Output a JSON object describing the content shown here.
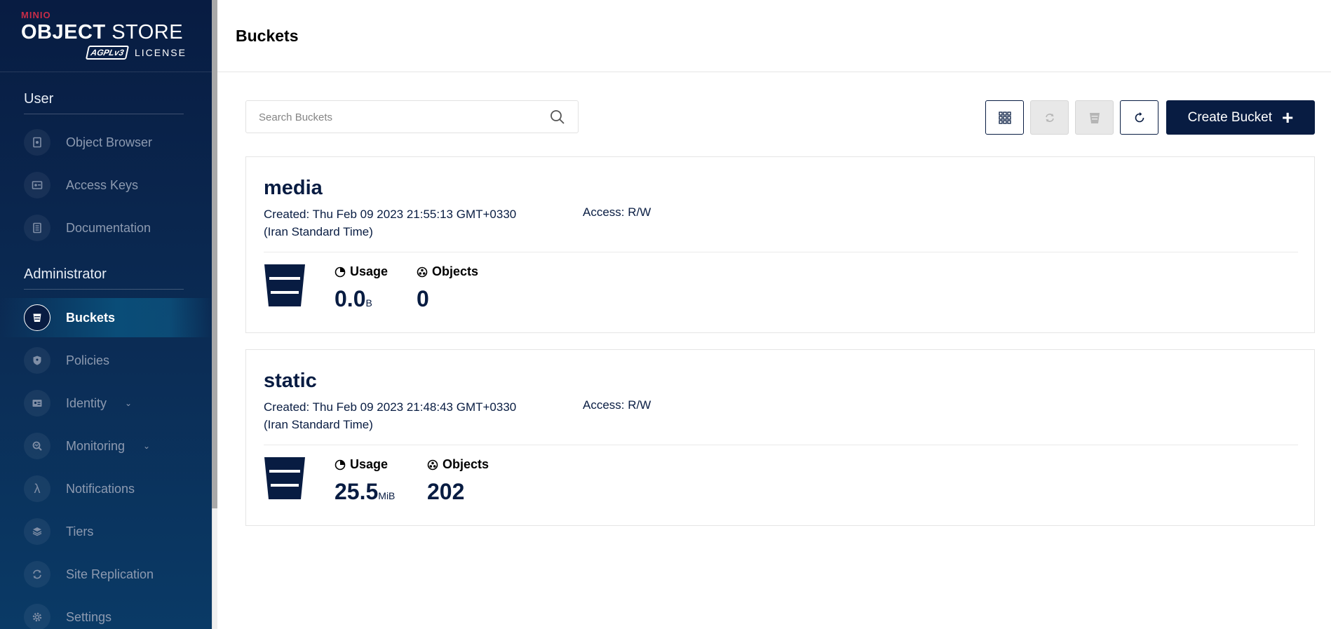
{
  "brand": {
    "top": "MINIO",
    "product_bold": "OBJECT",
    "product_rest": " STORE",
    "badge": "AGPLv3",
    "license": "LICENSE"
  },
  "sidebar": {
    "sections": [
      {
        "title": "User",
        "items": [
          {
            "label": "Object Browser",
            "icon": "object-browser-icon"
          },
          {
            "label": "Access Keys",
            "icon": "access-keys-icon"
          },
          {
            "label": "Documentation",
            "icon": "documentation-icon"
          }
        ]
      },
      {
        "title": "Administrator",
        "items": [
          {
            "label": "Buckets",
            "icon": "bucket-icon",
            "active": true
          },
          {
            "label": "Policies",
            "icon": "shield-icon"
          },
          {
            "label": "Identity",
            "icon": "identity-icon",
            "expandable": true
          },
          {
            "label": "Monitoring",
            "icon": "monitoring-icon",
            "expandable": true
          },
          {
            "label": "Notifications",
            "icon": "lambda-icon"
          },
          {
            "label": "Tiers",
            "icon": "layers-icon"
          },
          {
            "label": "Site Replication",
            "icon": "replication-icon"
          },
          {
            "label": "Settings",
            "icon": "gear-icon"
          }
        ]
      }
    ]
  },
  "header": {
    "title": "Buckets"
  },
  "toolbar": {
    "search_placeholder": "Search Buckets",
    "create_label": "Create Bucket",
    "create_symbol": "+"
  },
  "buckets": [
    {
      "name": "media",
      "created_line1": "Created: Thu Feb 09 2023 21:55:13 GMT+0330",
      "created_line2": "(Iran Standard Time)",
      "access": "Access: R/W",
      "usage_label": "Usage",
      "usage_value": "0.0",
      "usage_unit": "B",
      "objects_label": "Objects",
      "objects_value": "0"
    },
    {
      "name": "static",
      "created_line1": "Created: Thu Feb 09 2023 21:48:43 GMT+0330",
      "created_line2": "(Iran Standard Time)",
      "access": "Access: R/W",
      "usage_label": "Usage",
      "usage_value": "25.5",
      "usage_unit": "MiB",
      "objects_label": "Objects",
      "objects_value": "202"
    }
  ],
  "colors": {
    "primary": "#081c42",
    "sidebar_active": "#0a4d78",
    "brand_red": "#c72c48"
  }
}
